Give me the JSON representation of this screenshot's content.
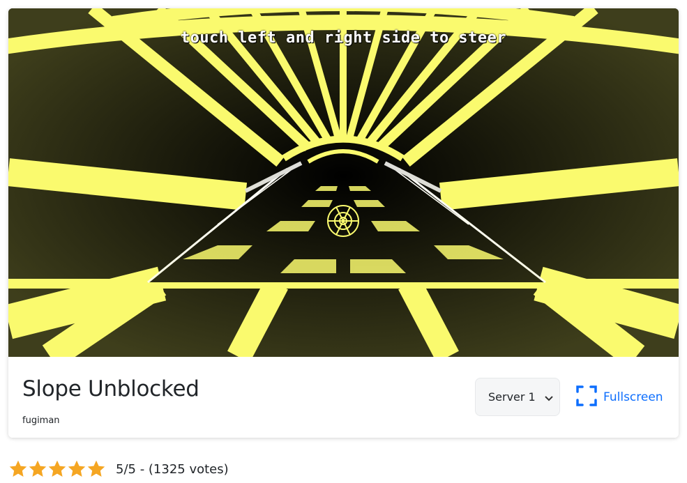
{
  "game": {
    "hint": "touch left and right side to steer",
    "colors": {
      "background": "#000000",
      "track": "#fafa6e",
      "edge": "#ffffff"
    }
  },
  "info": {
    "title": "Slope Unblocked",
    "author": "fugiman"
  },
  "controls": {
    "server_selected": "Server 1",
    "fullscreen_label": "Fullscreen",
    "accent": "#0d6efd"
  },
  "rating": {
    "stars": 5,
    "max_stars": 5,
    "text": "5/5 - (1325 votes)",
    "star_color": "#f5a623"
  }
}
